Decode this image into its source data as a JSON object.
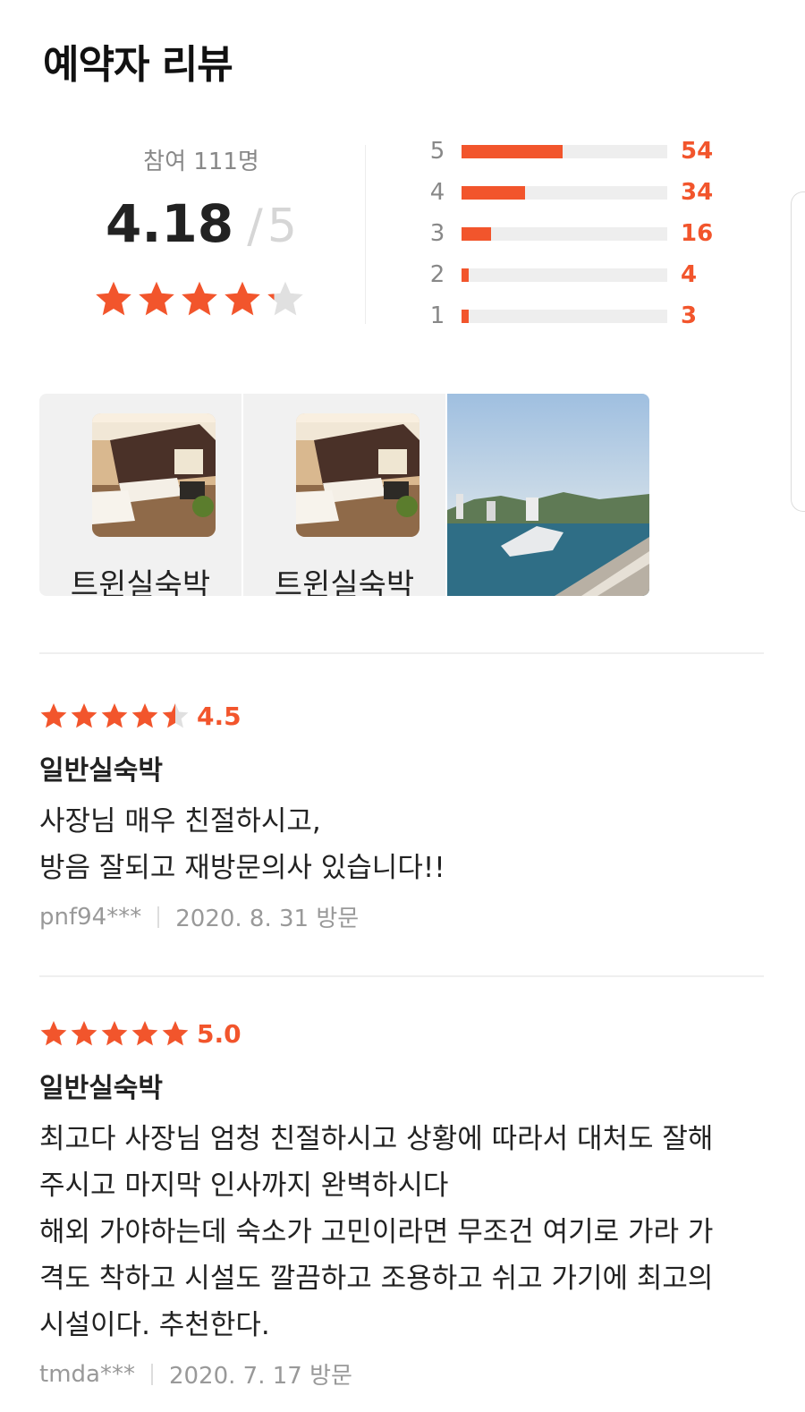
{
  "header": {
    "title": "예약자 리뷰"
  },
  "summary": {
    "participants": "참여 111명",
    "score": "4.18",
    "separator": "/",
    "max": "5",
    "star_rating": 4.18,
    "accent_color": "#f2552c",
    "distribution": [
      {
        "label": "5",
        "count": "54",
        "fraction": 0.49
      },
      {
        "label": "4",
        "count": "34",
        "fraction": 0.31
      },
      {
        "label": "3",
        "count": "16",
        "fraction": 0.145
      },
      {
        "label": "2",
        "count": "4",
        "fraction": 0.036
      },
      {
        "label": "1",
        "count": "3",
        "fraction": 0.027
      }
    ]
  },
  "photos": [
    {
      "caption": "트윈실숙박",
      "icon": "hotel-room-photo"
    },
    {
      "caption": "트윈실숙박",
      "icon": "hotel-room-photo"
    },
    {
      "caption": "",
      "icon": "harbor-city-photo"
    }
  ],
  "reviews": [
    {
      "rating_text": "4.5",
      "rating": 4.5,
      "room": "일반실숙박",
      "text": "사장님 매우 친절하시고,\n방음 잘되고 재방문의사 있습니다!!",
      "user": "pnf94***",
      "date": "2020. 8. 31 방문"
    },
    {
      "rating_text": "5.0",
      "rating": 5.0,
      "room": "일반실숙박",
      "text": "최고다 사장님 엄청 친절하시고 상황에 따라서 대처도 잘해\n주시고 마지막 인사까지 완벽하시다\n해외 가야하는데 숙소가 고민이라면 무조건 여기로 가라 가\n격도 착하고 시설도 깔끔하고 조용하고 쉬고 가기에 최고의\n시설이다. 추천한다.",
      "user": "tmda***",
      "date": "2020. 7. 17 방문"
    }
  ]
}
